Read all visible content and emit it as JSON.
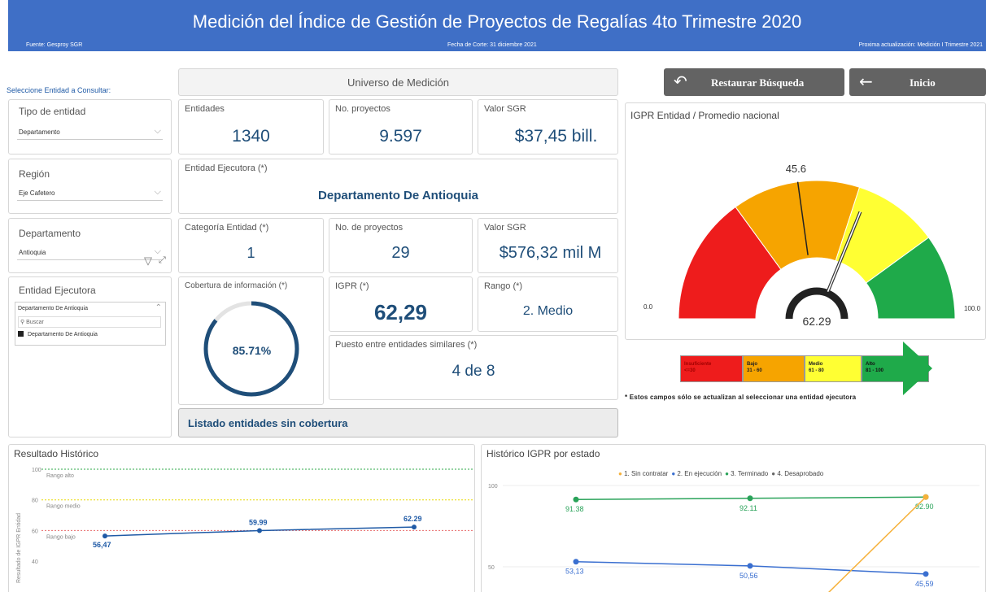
{
  "header": {
    "title": "Medición del Índice de Gestión de Proyectos de Regalías 4to Trimestre 2020",
    "source": "Fuente: Gesproy SGR",
    "cutoff": "Fecha de Corte: 31 diciembre 2021",
    "next_update": "Proxima actualización: Medición I Trimestre 2021"
  },
  "filters": {
    "heading": "Seleccione Entidad a Consultar:",
    "tipo_entidad": {
      "label": "Tipo de entidad",
      "value": "Departamento"
    },
    "region": {
      "label": "Región",
      "value": "Eje Cafetero"
    },
    "departamento": {
      "label": "Departamento",
      "value": "Antioquia"
    },
    "entidad_ejecutora": {
      "label": "Entidad Ejecutora",
      "value": "Departamento De Antioquia",
      "search_placeholder": "Buscar",
      "option": "Departamento De Antioquia"
    }
  },
  "universe": {
    "title": "Universo de Medición",
    "entidades": {
      "label": "Entidades",
      "value": "1340"
    },
    "proyectos": {
      "label": "No. proyectos",
      "value": "9.597"
    },
    "valor": {
      "label": "Valor SGR",
      "value": "$37,45 bill."
    }
  },
  "entity": {
    "ejecutora_label": "Entidad Ejecutora (*)",
    "ejecutora_value": "Departamento De Antioquia",
    "categoria": {
      "label": "Categoría Entidad (*)",
      "value": "1"
    },
    "proyectos": {
      "label": "No. de proyectos",
      "value": "29"
    },
    "valor": {
      "label": "Valor SGR",
      "value": "$576,32 mil M"
    },
    "cobertura": {
      "label": "Cobertura de información (*)",
      "value": "85.71%",
      "fraction": 0.8571
    },
    "igpr": {
      "label": "IGPR (*)",
      "value": "62,29"
    },
    "rango": {
      "label": "Rango (*)",
      "value": "2. Medio"
    },
    "puesto": {
      "label": "Puesto entre entidades similares (*)",
      "value": "4 de 8"
    },
    "sin_cobertura": "Listado entidades sin cobertura"
  },
  "buttons": {
    "restaurar": "Restaurar Búsqueda",
    "inicio": "Inicio"
  },
  "gauge": {
    "title": "IGPR Entidad / Promedio nacional",
    "min_label": "0.0",
    "max_label": "100.0",
    "value": 62.29,
    "value_label": "62.29",
    "target": 45.6,
    "target_label": "45.6",
    "bands": [
      {
        "from": 0,
        "to": 30,
        "color": "#ee1c1c"
      },
      {
        "from": 30,
        "to": 60,
        "color": "#f6a400"
      },
      {
        "from": 60,
        "to": 80,
        "color": "#ffff33"
      },
      {
        "from": 80,
        "to": 100,
        "color": "#1faa4a"
      }
    ]
  },
  "legend": [
    {
      "name": "Insuficiente",
      "range": "<=30",
      "color": "#ee1c1c",
      "text_color": "#a00000"
    },
    {
      "name": "Bajo",
      "range": "31 - 60",
      "color": "#f6a400",
      "text_color": "#222"
    },
    {
      "name": "Medio",
      "range": "61 - 80",
      "color": "#ffff33",
      "text_color": "#222"
    },
    {
      "name": "Alto",
      "range": "81 - 100",
      "color": "#1faa4a",
      "text_color": "#111"
    }
  ],
  "note": "* Estos campos sólo se actualizan al seleccionar una entidad ejecutora",
  "chart_data": [
    {
      "type": "line",
      "title": "Resultado Histórico",
      "ylabel": "Resultado de IGPR Entidad",
      "yticks": [
        "100",
        "80",
        "60",
        "40"
      ],
      "ylim": [
        30,
        100
      ],
      "reference_lines": [
        {
          "label": "Rango alto",
          "y": 100,
          "color": "#2eaa4a"
        },
        {
          "label": "Rango medio",
          "y": 80,
          "color": "#e8d800"
        },
        {
          "label": "Rango bajo",
          "y": 60,
          "color": "#e86a6a"
        }
      ],
      "series": [
        {
          "values": [
            56.47,
            59.99,
            62.29
          ],
          "labels": [
            "56,47",
            "59.99",
            "62.29"
          ],
          "color": "#1f5aa6"
        }
      ]
    },
    {
      "type": "line",
      "title": "Histórico IGPR por estado",
      "legend": [
        "1. Sin contratar",
        "2. En ejecución",
        "3. Terminado",
        "4. Desaprobado"
      ],
      "legend_colors": [
        "#f6b13a",
        "#3a6fd0",
        "#2aa35a",
        "#666666"
      ],
      "yticks": [
        "100",
        "50"
      ],
      "ylim": [
        30,
        110
      ],
      "series": [
        {
          "name": "3. Terminado",
          "values": [
            91.38,
            92.11,
            92.9
          ],
          "labels": [
            "91.38",
            "92.11",
            "92.90"
          ],
          "color": "#2aa35a"
        },
        {
          "name": "2. En ejecución",
          "values": [
            53.13,
            50.56,
            45.59
          ],
          "labels": [
            "53,13",
            "50,56",
            "45,59"
          ],
          "color": "#3a6fd0"
        },
        {
          "name": "1. Sin contratar",
          "values": [
            null,
            null,
            92.9
          ],
          "labels": [
            "",
            "",
            "92.90"
          ],
          "color": "#f6b13a"
        }
      ]
    }
  ]
}
